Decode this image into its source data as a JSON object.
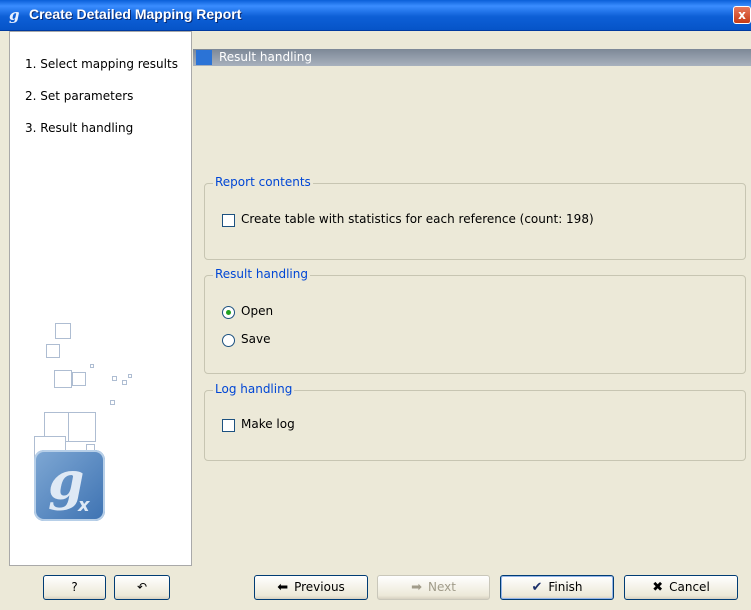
{
  "window": {
    "app_icon": "g",
    "title": "Create Detailed Mapping Report",
    "close_glyph": "x"
  },
  "sidebar": {
    "steps": [
      {
        "label": "1.  Select mapping results"
      },
      {
        "label": "2.  Set parameters"
      },
      {
        "label": "3.  Result handling"
      }
    ],
    "logo": "g",
    "logo_sub": "x"
  },
  "main": {
    "section_title": "Result handling",
    "report_contents": {
      "title": "Report contents",
      "checkbox_label": "Create table with statistics for each reference (count: 198)",
      "checked": false
    },
    "result_handling": {
      "title": "Result handling",
      "options": [
        {
          "label": "Open",
          "selected": true
        },
        {
          "label": "Save",
          "selected": false
        }
      ]
    },
    "log_handling": {
      "title": "Log handling",
      "checkbox_label": "Make log",
      "checked": false
    }
  },
  "buttons": {
    "help": "?",
    "reset_icon": "reset-icon",
    "previous": "Previous",
    "next": "Next",
    "finish": "Finish",
    "cancel": "Cancel"
  }
}
